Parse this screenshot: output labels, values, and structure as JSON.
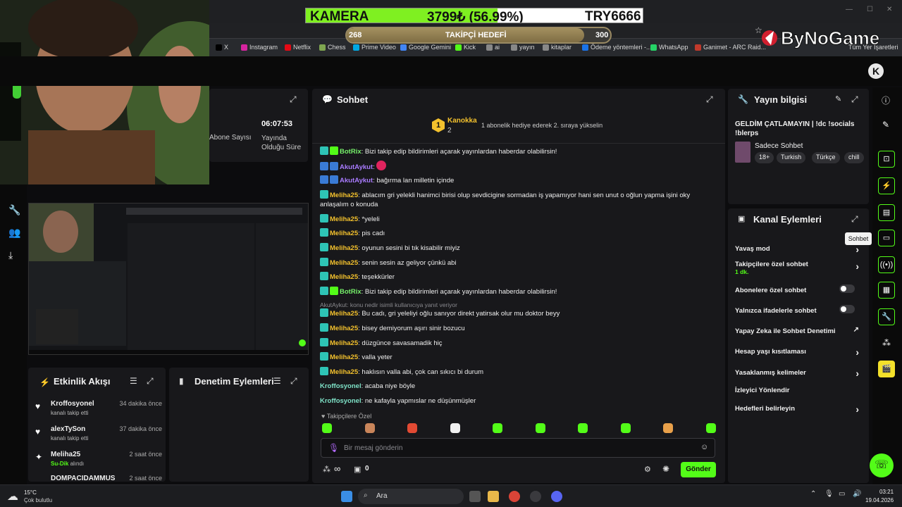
{
  "browser": {
    "bookmarks": [
      "X",
      "Instagram",
      "Netflix",
      "Chess",
      "Prime Video",
      "Google Gemini",
      "Kick",
      "ai",
      "yayın",
      "kitaplar",
      "Ödeme yöntemleri -...",
      "WhatsApp",
      "Ganimet - ARC Raid..."
    ],
    "bookmark_colors": [
      "#000000",
      "#d6249f",
      "#e50914",
      "#7fa650",
      "#00a8e1",
      "#4285f4",
      "#53fc18",
      "#888888",
      "#888888",
      "#888888",
      "#1a73e8",
      "#25d366",
      "#c0392b"
    ],
    "all_bookmarks": "Tüm Yer İşaretleri"
  },
  "overlay": {
    "kamera_label": "KAMERA",
    "kamera_amount": "3799₺ (56.99%)",
    "kamera_fraction": 0.5699,
    "kamera_code": "TRY6666",
    "goal_min": "268",
    "goal_label": "TAKİPÇİ HEDEFİ",
    "goal_max": "300",
    "goal_fraction": 0.9,
    "logo": "ByNoGame"
  },
  "stats": {
    "subs_label": "Abone Sayısı",
    "uptime_value": "06:07:53",
    "uptime_label": "Yayında Olduğu Süre"
  },
  "activity": {
    "title": "Etkinlik Akışı",
    "items": [
      {
        "name": "Kroffosyonel",
        "time": "34 dakika önce",
        "sub": "kanalı takip etti"
      },
      {
        "name": "alexTySon",
        "time": "37 dakika önce",
        "sub": "kanalı takip etti"
      },
      {
        "name": "Meliha25",
        "time": "2 saat önce",
        "sub_strong": "Su-Dik",
        "sub": "alındı"
      },
      {
        "name": "DOMPACIDAMMUS",
        "time": "2 saat önce"
      }
    ]
  },
  "mod_actions": {
    "title": "Denetim Eylemleri"
  },
  "chat": {
    "title": "Sohbet",
    "pinned_rank": "1",
    "pinned_user": "Kanokka",
    "pinned_count": "2",
    "pinned_hint": "1 abonelik hediye ederek 2. sıraya yükselin",
    "messages": [
      {
        "user": "BotRix",
        "text": "Bizi takip edip bildirimleri açarak yayınlardan haberdar olabilirsin!",
        "cls": "u-g"
      },
      {
        "user": "AkutAykut",
        "text": "",
        "cls": "u-p"
      },
      {
        "user": "AkutAykut",
        "text": "bağırma lan milletin içinde",
        "cls": "u-p"
      },
      {
        "user": "Meliha25",
        "text": "ablacım gri yelekli hanimci birisi olup sevdicigine sormadan iş yapamıyor hani sen unut o oğlun yapma işini oky anlaşalım o konuda",
        "cls": "u-o"
      },
      {
        "user": "Meliha25",
        "text": "*yeleli",
        "cls": "u-o"
      },
      {
        "user": "Meliha25",
        "text": "pis cadı",
        "cls": "u-o"
      },
      {
        "user": "Meliha25",
        "text": "oyunun sesini bi tık kisabilir miyiz",
        "cls": "u-o"
      },
      {
        "user": "Meliha25",
        "text": "senin sesin az geliyor çünkü abi",
        "cls": "u-o"
      },
      {
        "user": "Meliha25",
        "text": "teşekkürler",
        "cls": "u-o"
      },
      {
        "user": "BotRix",
        "text": "Bizi takip edip bildirimleri açarak yayınlardan haberdar olabilirsin!",
        "cls": "u-g"
      },
      {
        "reply": "AkutAykut: konu nedir isimli kullanıcıya yanıt veriyor"
      },
      {
        "user": "Meliha25",
        "text": "Bu cadı, gri yeleliyi oğlu sanıyor direkt yatirsak olur mu doktor beyy",
        "cls": "u-o"
      },
      {
        "user": "Meliha25",
        "text": "bisey demiyorum aşırı sinir bozucu",
        "cls": "u-o"
      },
      {
        "user": "Meliha25",
        "text": "düzgünce savasamadik hiç",
        "cls": "u-o"
      },
      {
        "user": "Meliha25",
        "text": "valla yeter",
        "cls": "u-o"
      },
      {
        "user": "Meliha25",
        "text": "haklısın valla abi, çok can sıkıcı bi durum",
        "cls": "u-o"
      },
      {
        "user": "Kroffosyonel",
        "text": "acaba niye böyle",
        "cls": "u-t"
      },
      {
        "user": "Kroffosyonel",
        "text": "ne kafayla yapmıslar ne düşünmüşler",
        "cls": "u-t"
      }
    ],
    "followers_only": "Takipçilere Özel",
    "input_placeholder": "Bir mesaj gönderin",
    "points": "∞",
    "gifts": "0",
    "send_label": "Gönder"
  },
  "stream_info": {
    "title": "Yayın bilgisi",
    "stream_title": "GELDİM ÇATLAMAYIN | !dc !socials !blerps",
    "category": "Sadece Sohbet",
    "tags": [
      "18+",
      "Turkish",
      "Türkçe",
      "chill"
    ]
  },
  "channel_actions": {
    "title": "Kanal Eylemleri",
    "items": [
      {
        "label": "Yavaş mod",
        "kind": "chevron"
      },
      {
        "label": "Takipçilere özel sohbet",
        "sub": "1 dk.",
        "kind": "chevron"
      },
      {
        "label": "Abonelere özel sohbet",
        "kind": "toggle"
      },
      {
        "label": "Yalnızca ifadelerle sohbet",
        "kind": "toggle"
      },
      {
        "label": "Yapay Zeka ile Sohbet Denetimi",
        "kind": "external"
      },
      {
        "label": "Hesap yaşı kısıtlaması",
        "kind": "chevron"
      },
      {
        "label": "Yasaklanmış kelimeler",
        "kind": "chevron"
      },
      {
        "label": "İzleyici Yönlendir",
        "kind": "none"
      },
      {
        "label": "Hedefleri belirleyin",
        "kind": "chevron"
      }
    ]
  },
  "tooltip": "Sohbet",
  "taskbar": {
    "temp": "15°C",
    "weather": "Çok bulutlu",
    "search": "Ara",
    "time": "03:21",
    "date": "19.04.2026"
  }
}
